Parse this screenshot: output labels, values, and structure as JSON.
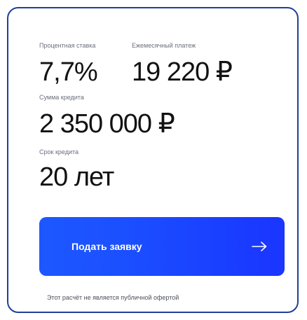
{
  "rate": {
    "label": "Процентная ставка",
    "value": "7,7%"
  },
  "payment": {
    "label": "Ежемесячный платеж",
    "value": "19 220 ₽"
  },
  "loan_amount": {
    "label": "Сумма кредита",
    "value": "2 350 000 ₽"
  },
  "loan_term": {
    "label": "Срок кредита",
    "value": "20 лет"
  },
  "cta": {
    "label": "Подать заявку",
    "icon": "arrow-right-icon"
  },
  "disclaimer": "Этот расчёт не является публичной офертой",
  "colors": {
    "border": "#1f3f9a",
    "cta_start": "#1d58ff",
    "cta_end": "#1a35ff",
    "text": "#121212",
    "muted": "#6b6f7b"
  }
}
